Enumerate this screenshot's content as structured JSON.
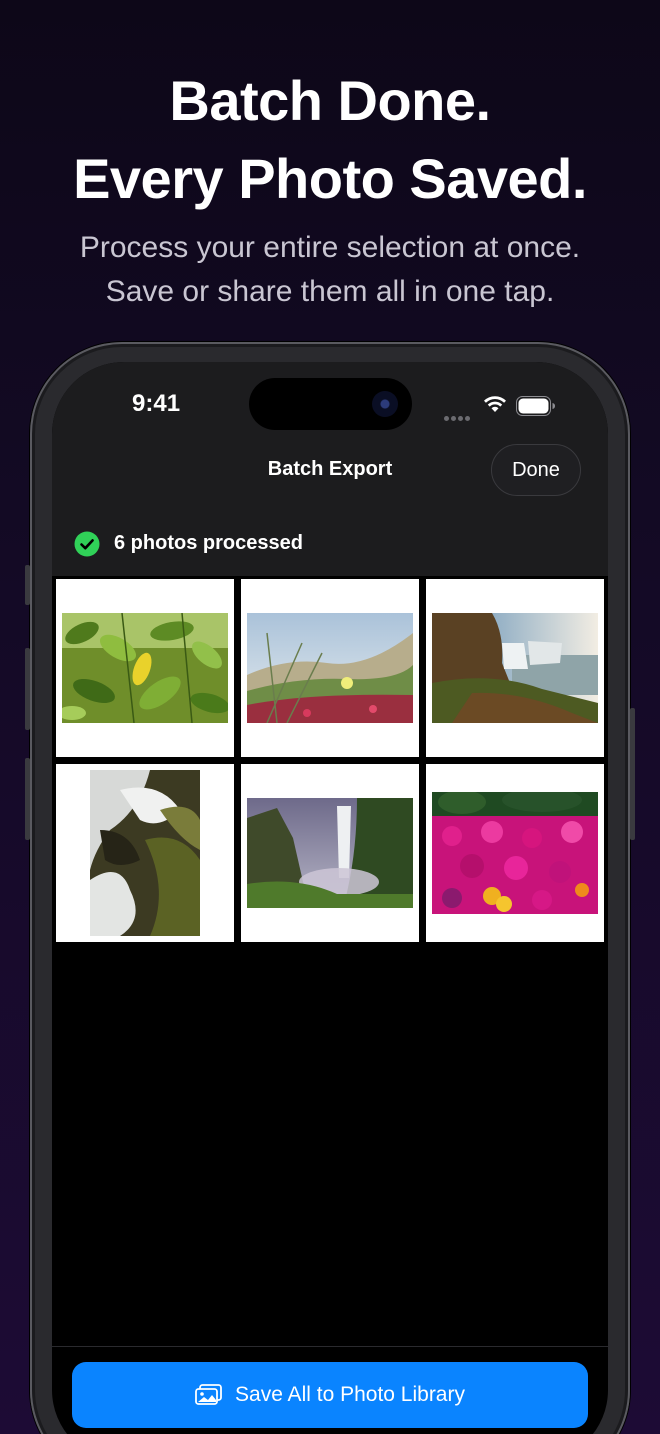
{
  "headline": {
    "line1": "Batch Done.",
    "line2": "Every Photo Saved."
  },
  "subheadline": {
    "line1": "Process your entire selection at once.",
    "line2": "Save or share them all in one tap."
  },
  "status_bar": {
    "time": "9:41",
    "icons": [
      "signal-dots-icon",
      "wifi-icon",
      "battery-icon"
    ]
  },
  "nav": {
    "title": "Batch Export",
    "done_label": "Done"
  },
  "status": {
    "icon": "checkmark-circle-icon",
    "text": "6 photos processed",
    "color": "#30d158"
  },
  "photos": [
    {
      "subject": "green leaves with yellow leaf"
    },
    {
      "subject": "dune grass and flowers"
    },
    {
      "subject": "waterfall over coastal cliff"
    },
    {
      "subject": "cascading stream over mossy rocks"
    },
    {
      "subject": "misty waterfall in green gorge"
    },
    {
      "subject": "magenta ice plant flowers"
    }
  ],
  "footer": {
    "save_icon": "photo-library-icon",
    "save_label": "Save All to Photo Library",
    "accent": "#0a84ff"
  }
}
